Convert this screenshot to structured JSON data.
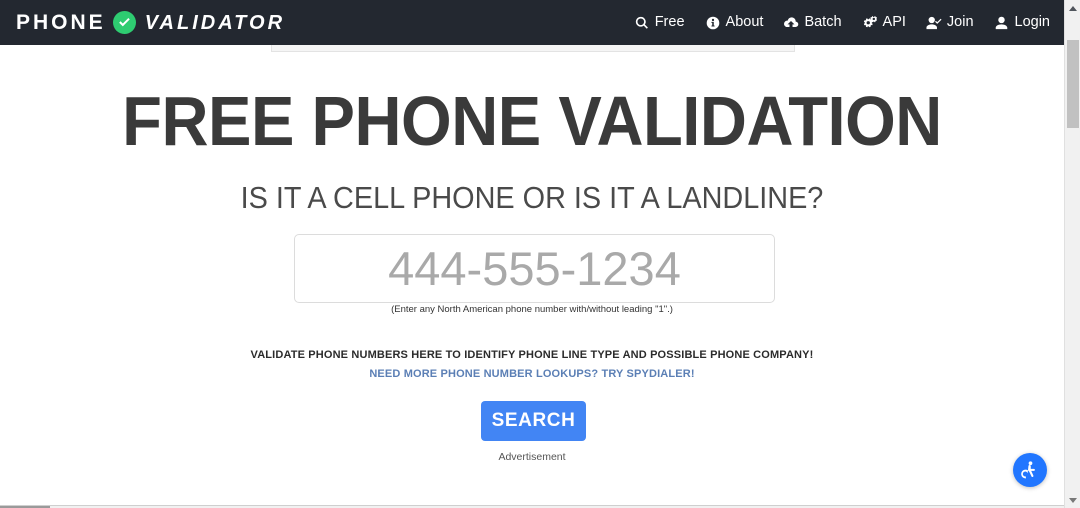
{
  "brand": {
    "word1": "PHONE",
    "word2": "VALIDATOR",
    "badge_icon": "check-circle-icon",
    "badge_color": "#2ecc71"
  },
  "nav": {
    "items": [
      {
        "label": "Free",
        "icon": "search-icon"
      },
      {
        "label": "About",
        "icon": "info-circle-icon"
      },
      {
        "label": "Batch",
        "icon": "cloud-upload-icon"
      },
      {
        "label": "API",
        "icon": "cogs-icon"
      },
      {
        "label": "Join",
        "icon": "user-plus-icon"
      },
      {
        "label": "Login",
        "icon": "user-icon"
      }
    ],
    "background_color": "#232830"
  },
  "hero": {
    "headline": "FREE PHONE VALIDATION",
    "subheadline": "IS IT A CELL PHONE OR IS IT A LANDLINE?"
  },
  "search": {
    "placeholder": "444-555-1234",
    "value": "",
    "hint": "(Enter any North American phone number with/without leading \"1\".)",
    "button_label": "SEARCH",
    "button_color": "#4285f4"
  },
  "promo": {
    "tagline": "VALIDATE PHONE NUMBERS HERE TO IDENTIFY PHONE LINE TYPE AND POSSIBLE PHONE COMPANY!",
    "link_text": "NEED MORE PHONE NUMBER LOOKUPS? TRY SPYDIALER!",
    "link_color": "#5b7fb5"
  },
  "ads": {
    "label": "Advertisement"
  },
  "accessibility": {
    "icon": "wheelchair-icon",
    "color": "#2176ff"
  }
}
